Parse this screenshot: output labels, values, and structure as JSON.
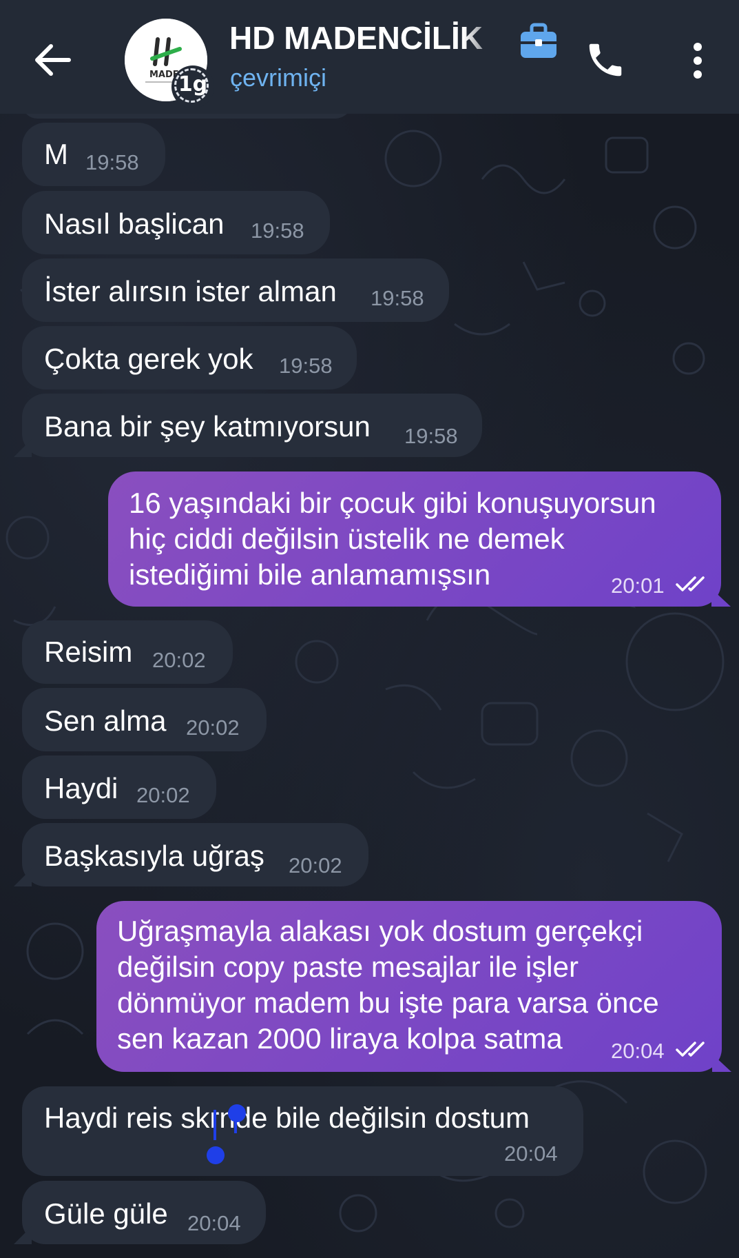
{
  "header": {
    "title": "HD MADENCİLİK",
    "status": "çevrimiçi",
    "avatar_text": "MADE",
    "badge_text": "1g",
    "icons": {
      "back": "arrow-left-icon",
      "business": "briefcase-icon",
      "call": "phone-icon",
      "menu": "more-vert-icon"
    }
  },
  "colors": {
    "header_bg": "#232a36",
    "incoming_bubble": "#272e3b",
    "outgoing_bubble_start": "#8a4fbf",
    "outgoing_bubble_end": "#6f42c8",
    "status_text": "#6fb3f0",
    "selection": "#1f3fe8"
  },
  "messages": [
    {
      "dir": "in",
      "text": "M",
      "time": "19:58"
    },
    {
      "dir": "in",
      "text": "Nasıl başlican",
      "time": "19:58"
    },
    {
      "dir": "in",
      "text": "İster alırsın ister alman",
      "time": "19:58"
    },
    {
      "dir": "in",
      "text": "Çokta gerek yok",
      "time": "19:58"
    },
    {
      "dir": "in",
      "text": "Bana bir şey katmıyorsun",
      "time": "19:58"
    },
    {
      "dir": "out",
      "lines": [
        "16 yaşındaki bir çocuk gibi konuşuyorsun",
        "hiç ciddi değilsin üstelik ne demek",
        "istediğimi bile anlamamışsın"
      ],
      "time": "20:01",
      "read": true
    },
    {
      "dir": "in",
      "text": "Reisim",
      "time": "20:02"
    },
    {
      "dir": "in",
      "text": "Sen alma",
      "time": "20:02"
    },
    {
      "dir": "in",
      "text": "Haydi",
      "time": "20:02"
    },
    {
      "dir": "in",
      "text": "Başkasıyla uğraş",
      "time": "20:02"
    },
    {
      "dir": "out",
      "lines": [
        "Uğraşmayla alakası yok dostum gerçekçi",
        "değilsin copy paste mesajlar ile işler",
        "dönmüyor madem bu işte para varsa önce",
        "sen kazan 2000 liraya kolpa satma"
      ],
      "time": "20:04",
      "read": true
    },
    {
      "dir": "in",
      "text": "Haydi reis skrnde bile değilsin dostum",
      "time": "20:04"
    },
    {
      "dir": "in",
      "text": "Güle güle",
      "time": "20:04"
    }
  ]
}
